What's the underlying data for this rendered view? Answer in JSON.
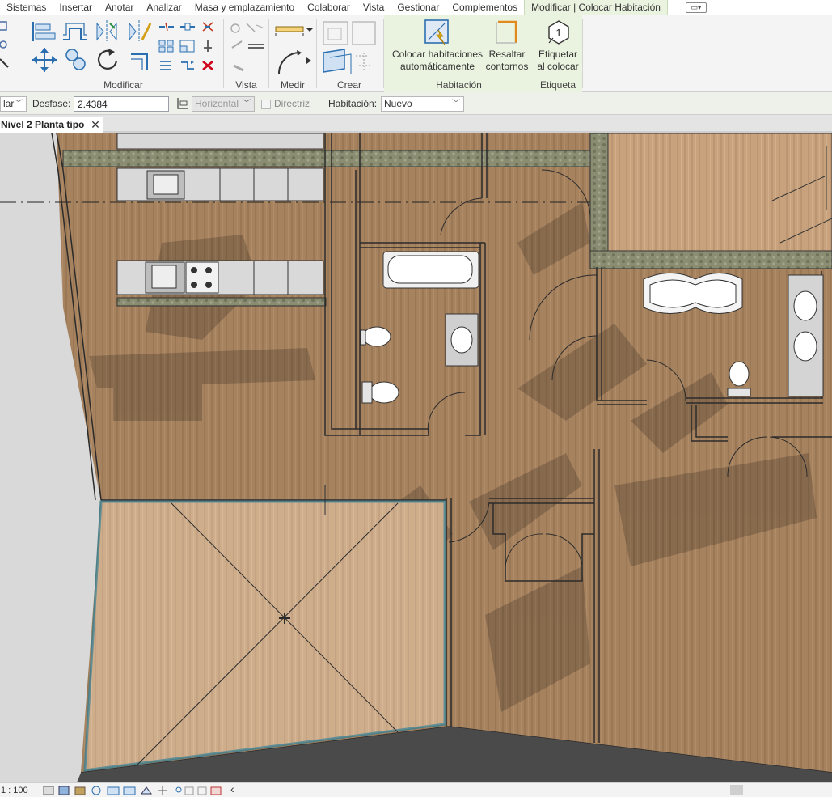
{
  "menu": {
    "items": [
      "Sistemas",
      "Insertar",
      "Anotar",
      "Analizar",
      "Masa y emplazamiento",
      "Colaborar",
      "Vista",
      "Gestionar",
      "Complementos"
    ],
    "active_tab": "Modificar | Colocar Habitación"
  },
  "ribbon": {
    "panels": {
      "modificar": "Modificar",
      "vista": "Vista",
      "medir": "Medir",
      "crear": "Crear",
      "habitacion": "Habitación",
      "etiqueta": "Etiqueta"
    },
    "buttons": {
      "auto_place_line1": "Colocar habitaciones",
      "auto_place_line2": "automáticamente",
      "highlight_line1": "Resaltar",
      "highlight_line2": "contornos",
      "tag_line1": "Etiquetar",
      "tag_line2": "al colocar",
      "tag_icon_number": "1"
    }
  },
  "options_bar": {
    "first_select": "lar",
    "offset_label": "Desfase:",
    "offset_value": "2.4384",
    "orientation_value": "Horizontal",
    "leader_label": "Directriz",
    "room_label": "Habitación:",
    "room_value": "Nuevo"
  },
  "view_tab": {
    "title": "Nivel 2 Planta tipo",
    "close": "✕"
  },
  "status_bar": {
    "scale": "1 : 100",
    "scroll_left": "‹"
  },
  "colors": {
    "context_tab_bg": "#eaf3df",
    "floor_wood": "#a6825f",
    "wall_line": "#2b2b2b",
    "room_outline": "#4f7f86"
  },
  "icons": [
    "align-icon",
    "offset-icon",
    "mirror-pick-icon",
    "split-icon",
    "move-icon",
    "copy-icon",
    "rotate-icon",
    "trim-icon",
    "array-icon",
    "scale-icon",
    "pin-icon",
    "delete-icon",
    "measure-icon",
    "arc-measure-icon",
    "create-group-icon",
    "create-part-icon",
    "auto-place-rooms-icon",
    "highlight-boundaries-icon",
    "tag-on-placement-icon"
  ]
}
